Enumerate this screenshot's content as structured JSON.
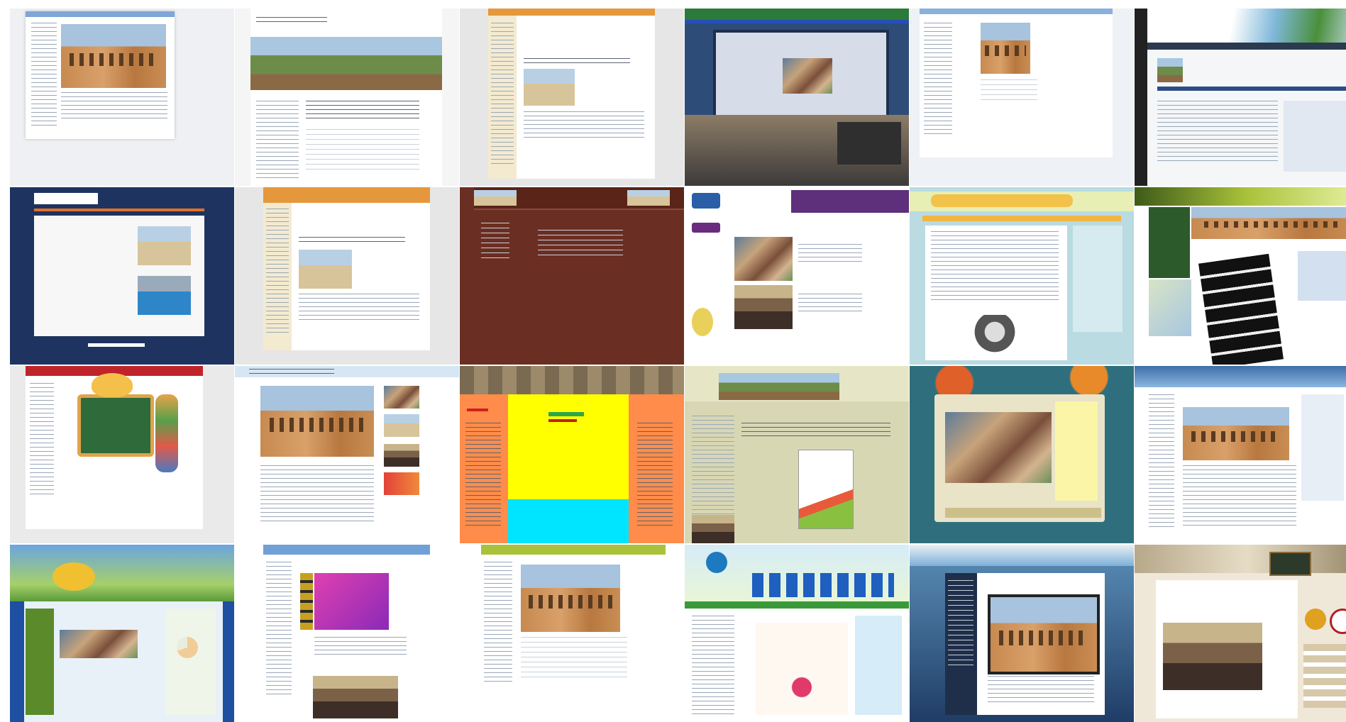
{
  "mosaic_title": "",
  "tiles": [
    {
      "id": "r1c1"
    },
    {
      "id": "r1c2"
    },
    {
      "id": "r1c3"
    },
    {
      "id": "r1c4"
    },
    {
      "id": "r1c5"
    },
    {
      "id": "r1c6"
    },
    {
      "id": "r2c1"
    },
    {
      "id": "r2c2"
    },
    {
      "id": "r2c3"
    },
    {
      "id": "r2c4"
    },
    {
      "id": "r2c5"
    },
    {
      "id": "r2c6"
    },
    {
      "id": "r3c1"
    },
    {
      "id": "r3c2"
    },
    {
      "id": "r3c3"
    },
    {
      "id": "r3c4"
    },
    {
      "id": "r3c5"
    },
    {
      "id": "r3c6"
    },
    {
      "id": "r4c1"
    },
    {
      "id": "r4c2"
    },
    {
      "id": "r4c3"
    },
    {
      "id": "r4c4"
    },
    {
      "id": "r4c5"
    },
    {
      "id": "r4c6"
    }
  ],
  "colors": {
    "navy": "#1f3360",
    "brown": "#6b2e22",
    "olive": "#d8d7b4",
    "teal": "#2f6f7d",
    "yellow": "#ffff00",
    "cyan": "#00e5ff",
    "orange": "#ff8c4a",
    "green_banner": "#a9c23a"
  }
}
